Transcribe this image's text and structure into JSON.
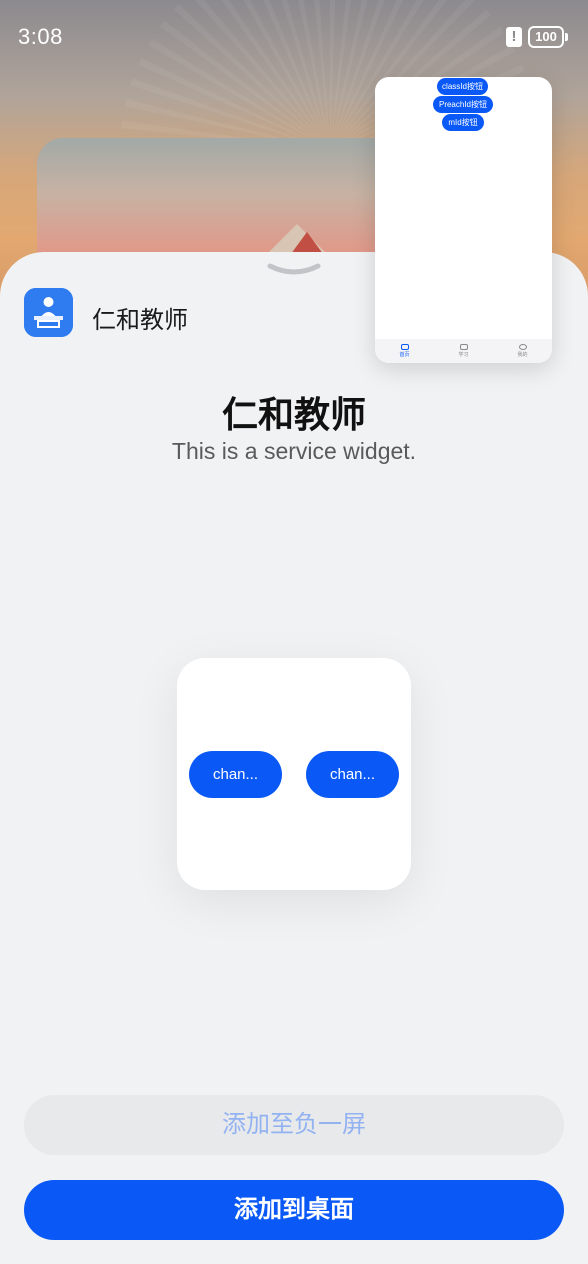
{
  "status_bar": {
    "time": "3:08",
    "alert_glyph": "!",
    "battery": "100"
  },
  "app": {
    "name": "仁和教师",
    "icon": "teacher-logo-icon"
  },
  "widget": {
    "title": "仁和教师",
    "description": "This is a service widget.",
    "buttons": [
      "chan...",
      "chan..."
    ]
  },
  "mini_preview": {
    "pills": [
      "classId按钮",
      "PreachId按钮",
      "mId按钮"
    ],
    "tabs": [
      "首页",
      "学习",
      "我的"
    ]
  },
  "actions": {
    "secondary": "添加至负一屏",
    "primary": "添加到桌面"
  },
  "colors": {
    "accent": "#0a59f7",
    "sheet_bg": "#f1f2f4",
    "secondary_text": "#93b2f2"
  }
}
